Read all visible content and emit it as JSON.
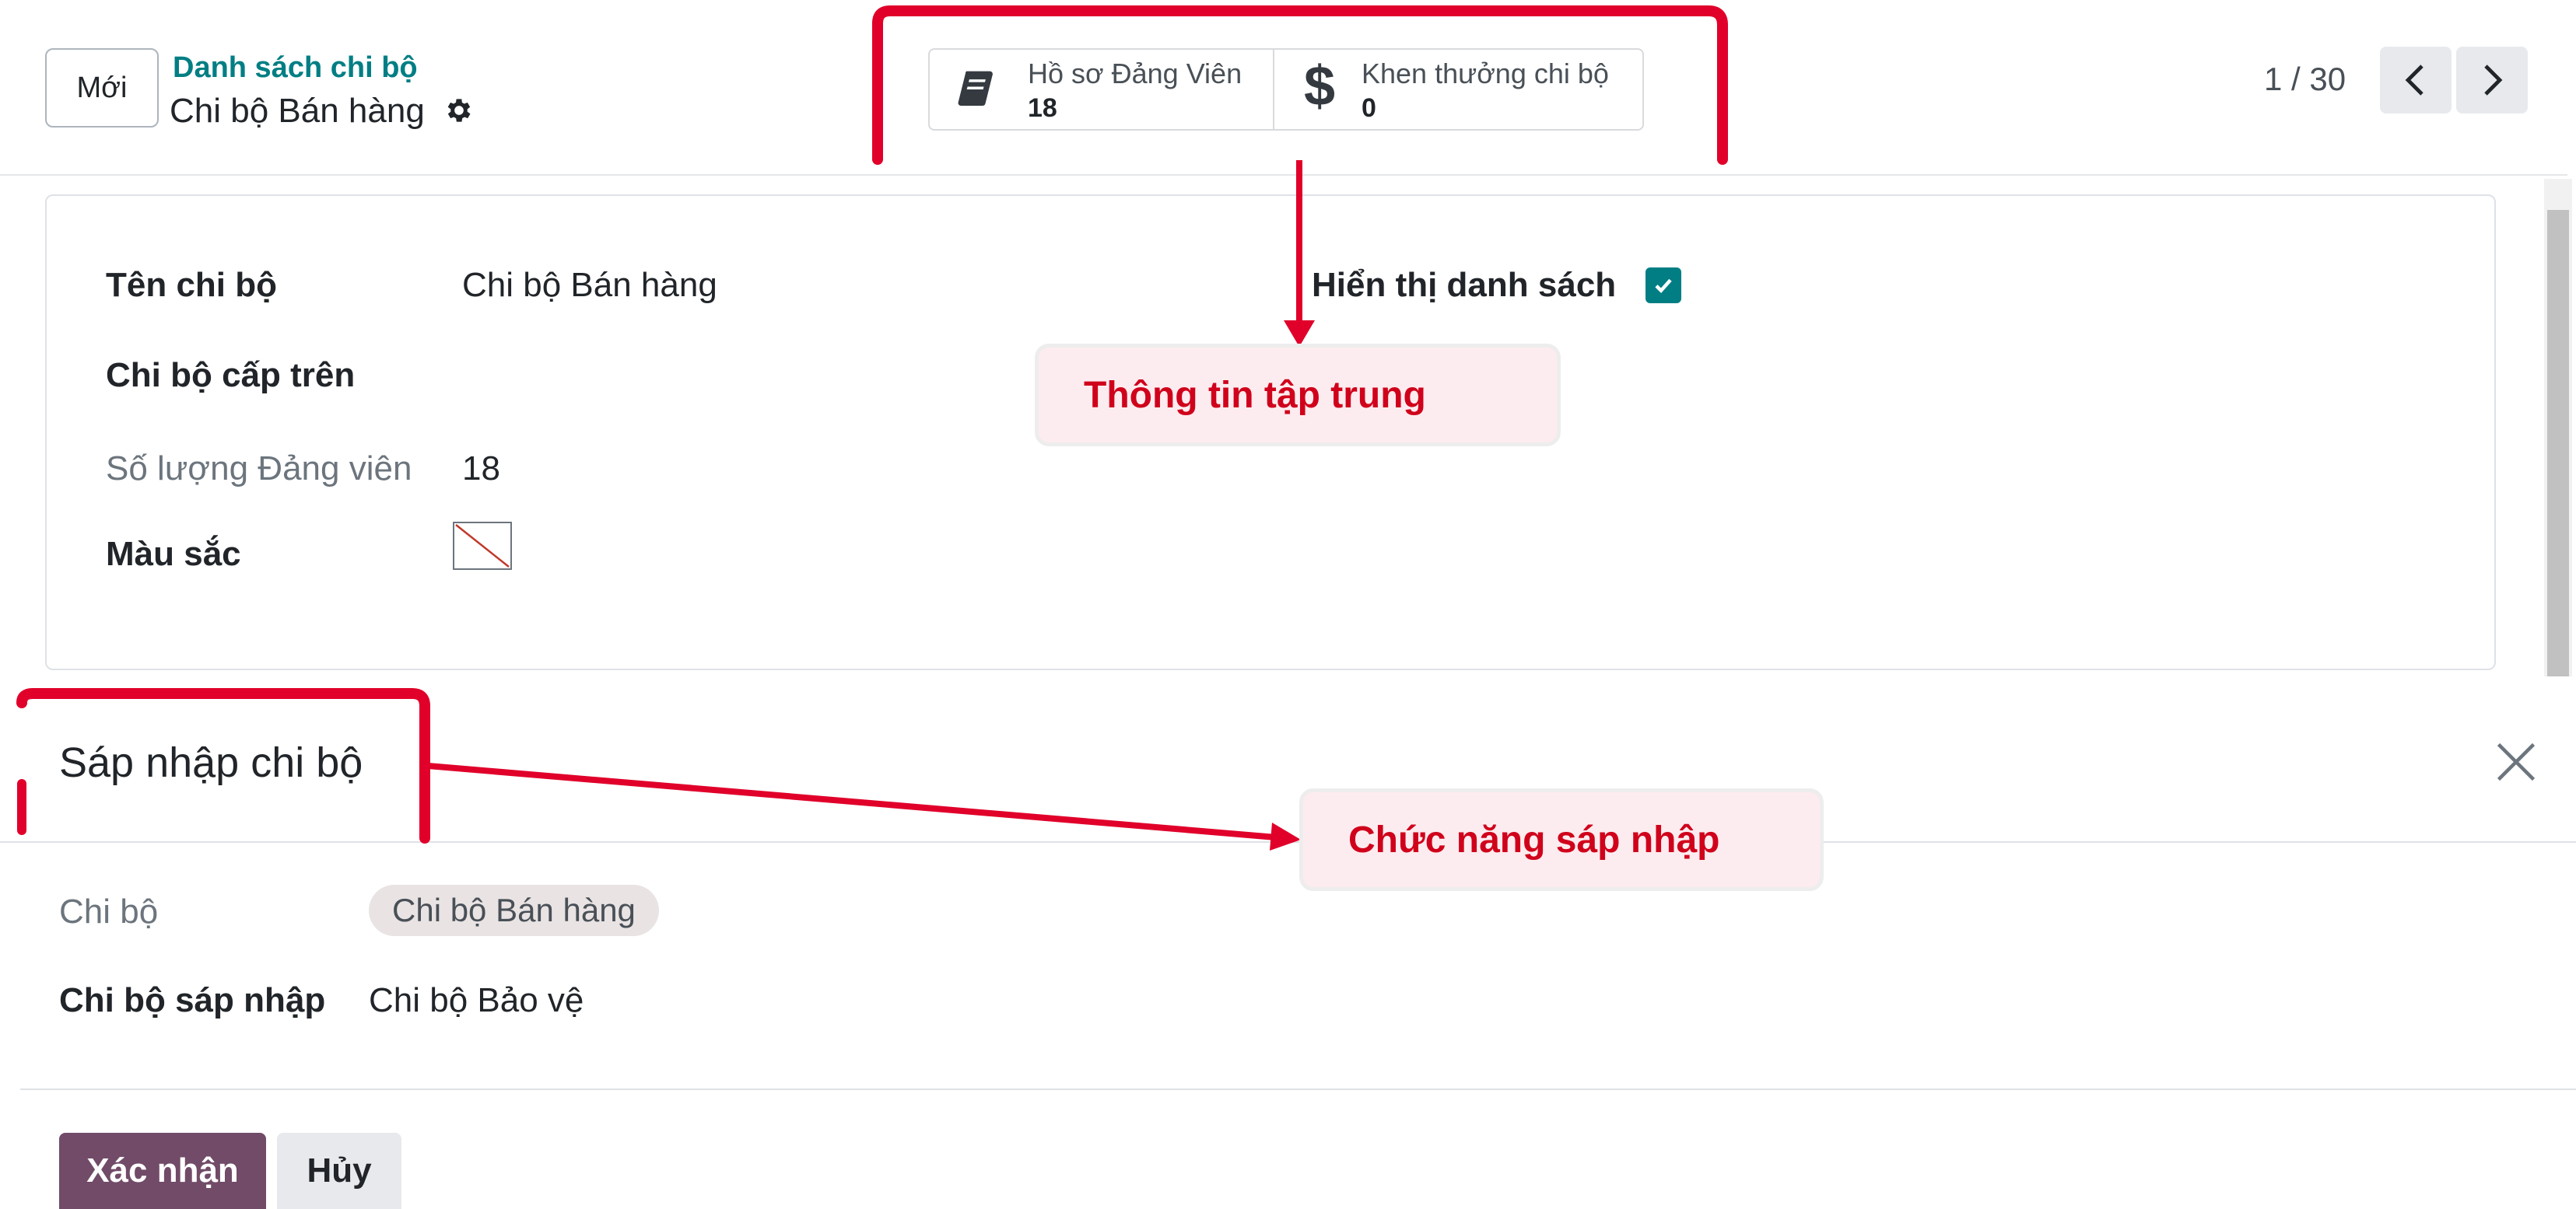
{
  "control_panel": {
    "new_button": "Mới",
    "breadcrumb_parent": "Danh sách chi bộ",
    "breadcrumb_current": "Chi bộ Bán hàng",
    "stat_buttons": [
      {
        "icon": "book-icon",
        "label": "Hồ sơ Đảng Viên",
        "value": "18"
      },
      {
        "icon": "dollar-icon",
        "label": "Khen thưởng chi bộ",
        "value": "0"
      }
    ],
    "pager": {
      "value": "1 / 30"
    }
  },
  "form": {
    "name_label": "Tên chi bộ",
    "name_value": "Chi bộ Bán hàng",
    "parent_label": "Chi bộ cấp trên",
    "parent_value": "",
    "member_count_label": "Số lượng Đảng viên",
    "member_count_value": "18",
    "color_label": "Màu sắc",
    "show_list_label": "Hiển thị danh sách",
    "show_list_checked": true
  },
  "dialog": {
    "title": "Sáp nhập chi bộ",
    "branch_label": "Chi bộ",
    "branch_tag": "Chi bộ Bán hàng",
    "merge_label": "Chi bộ sáp nhập",
    "merge_value": "Chi bộ Bảo vệ",
    "confirm_button": "Xác nhận",
    "cancel_button": "Hủy"
  },
  "annotations": {
    "focus_info": "Thông tin tập trung",
    "merge_function": "Chức năng sáp nhập",
    "highlight_color": "#e0002a"
  },
  "colors": {
    "brand_primary": "#714b67",
    "accent_teal": "#017e84"
  }
}
